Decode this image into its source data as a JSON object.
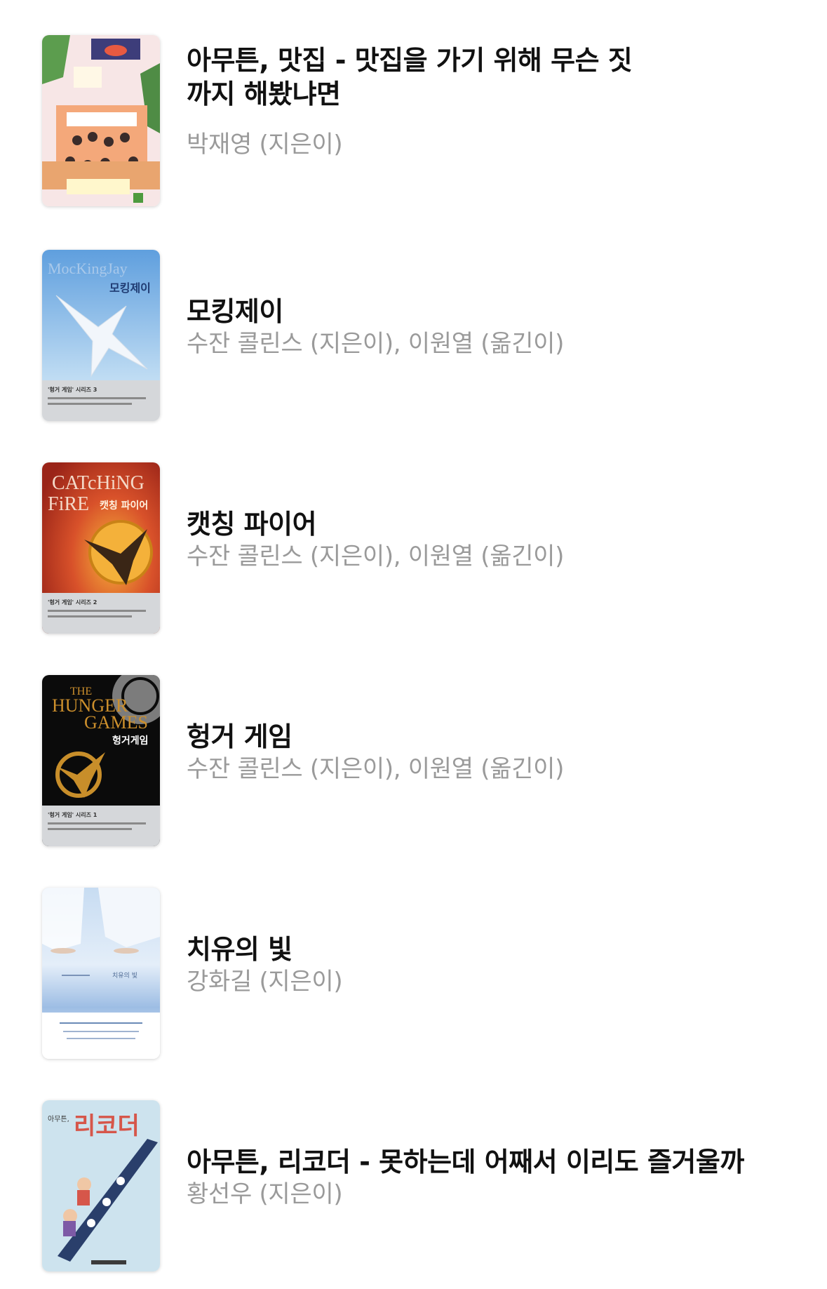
{
  "books": [
    {
      "title": "아무튼, 맛집 - 맛집을 가기 위해 무슨 짓까지 해봤냐면",
      "author": "박재영 (지은이)",
      "cover_icon": "book-cover-restaurant"
    },
    {
      "title": "모킹제이",
      "author": "수잔 콜린스 (지은이), 이원열 (옮긴이)",
      "cover_icon": "book-cover-mockingjay",
      "cover_text": {
        "en": "MocKingJay",
        "ko": "모킹제이",
        "series": "'헝거 게임' 시리즈 3"
      }
    },
    {
      "title": "캣칭 파이어",
      "author": "수잔 콜린스 (지은이), 이원열 (옮긴이)",
      "cover_icon": "book-cover-catching-fire",
      "cover_text": {
        "en1": "CATcHiNG",
        "en2": "FiRE",
        "ko": "캣칭 파이어",
        "series": "'헝거 게임' 시리즈 2"
      }
    },
    {
      "title": "헝거 게임",
      "author": "수잔 콜린스 (지은이), 이원열 (옮긴이)",
      "cover_icon": "book-cover-hunger-games",
      "cover_text": {
        "en1": "THE",
        "en2": "HUNGER",
        "en3": "GAMES",
        "ko": "헝거게임",
        "series": "'헝거 게임' 시리즈 1"
      }
    },
    {
      "title": "치유의 빛",
      "author": "강화길 (지은이)",
      "cover_icon": "book-cover-healing-light",
      "cover_text": {
        "ko": "치유의 빛"
      }
    },
    {
      "title": "아무튼, 리코더 - 못하는데 어째서 이리도 즐거울까",
      "author": "황선우 (지은이)",
      "cover_icon": "book-cover-recorder",
      "cover_text": {
        "ko": "리코더",
        "series": "아무튼,"
      }
    }
  ]
}
